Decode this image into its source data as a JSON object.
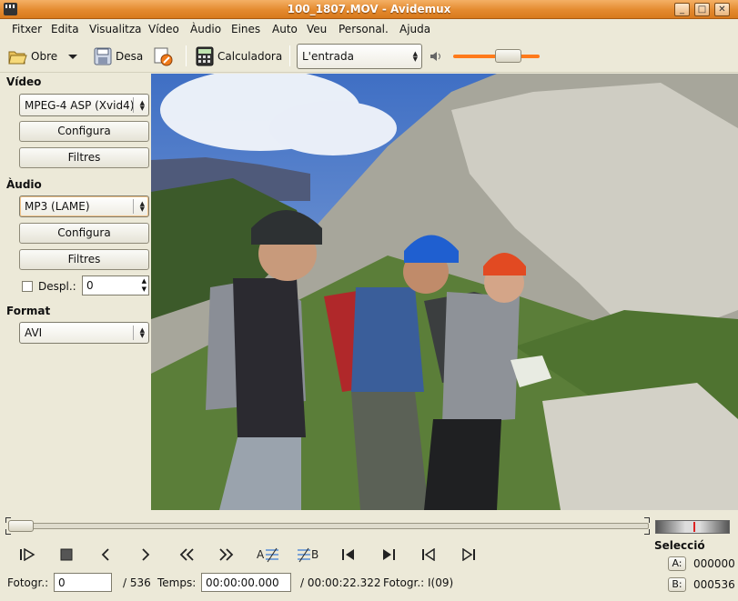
{
  "window": {
    "title": "100_1807.MOV - Avidemux"
  },
  "menu": [
    "Fitxer",
    "Edita",
    "Visualitza",
    "Vídeo",
    "Àudio",
    "Eines",
    "Auto",
    "Veu",
    "Personal.",
    "Ajuda"
  ],
  "toolbar": {
    "open_label": "Obre",
    "save_label": "Desa",
    "calculator_label": "Calculadora",
    "input_select": "L'entrada",
    "volume": 0.7
  },
  "video_panel": {
    "heading": "Vídeo",
    "codec": "MPEG-4 ASP (Xvid4)",
    "configure_label": "Configura",
    "filters_label": "Filtres"
  },
  "audio_panel": {
    "heading": "Àudio",
    "codec": "MP3 (LAME)",
    "configure_label": "Configura",
    "filters_label": "Filtres",
    "shift_label": "Despl.:",
    "shift_value": "0"
  },
  "format_panel": {
    "heading": "Format",
    "container": "AVI"
  },
  "timeline": {
    "position": 0.0
  },
  "status": {
    "frame_label": "Fotogr.:",
    "frame_value": "0",
    "frame_total": "/ 536",
    "time_label": "Temps:",
    "time_value": "00:00:00.000",
    "time_total": "/ 00:00:22.322",
    "frame_type": "Fotogr.: I(09)"
  },
  "selection": {
    "heading": "Selecció",
    "a_label": "A:",
    "a_value": "000000",
    "b_label": "B:",
    "b_value": "000536"
  },
  "colors": {
    "titlebar": "#e48a2f",
    "volume_fill": "#ff7a1a",
    "panel_bg": "#ece9d8"
  }
}
